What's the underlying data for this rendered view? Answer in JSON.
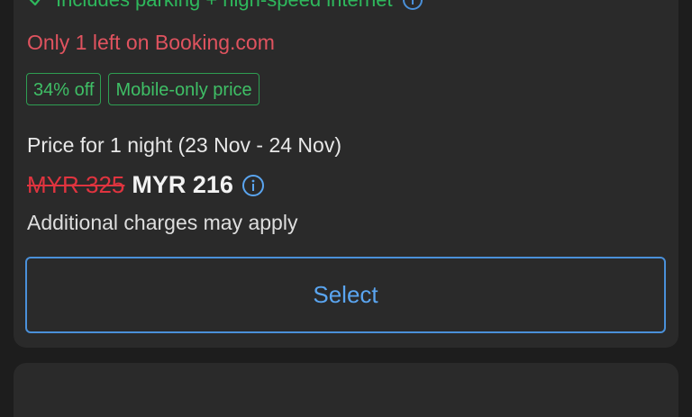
{
  "room_card": {
    "includes_text": "Includes parking + high-speed internet",
    "availability_text": "Only 1 left on Booking.com",
    "badges": [
      {
        "label": "34% off"
      },
      {
        "label": "Mobile-only price"
      }
    ],
    "price_for_text": "Price for 1 night (23 Nov - 24 Nov)",
    "original_price": "MYR 325",
    "discounted_price": "MYR 216",
    "additional_charges_text": "Additional charges may apply",
    "select_label": "Select"
  },
  "colors": {
    "background": "#1d1d1d",
    "card": "#2a2a2a",
    "availability": "#e0535f",
    "badge_green": "#3fbf66",
    "strike_red": "#e0343f",
    "button_blue": "#5aa5f0"
  },
  "icons": {
    "check": "check-icon",
    "info": "info-icon"
  }
}
